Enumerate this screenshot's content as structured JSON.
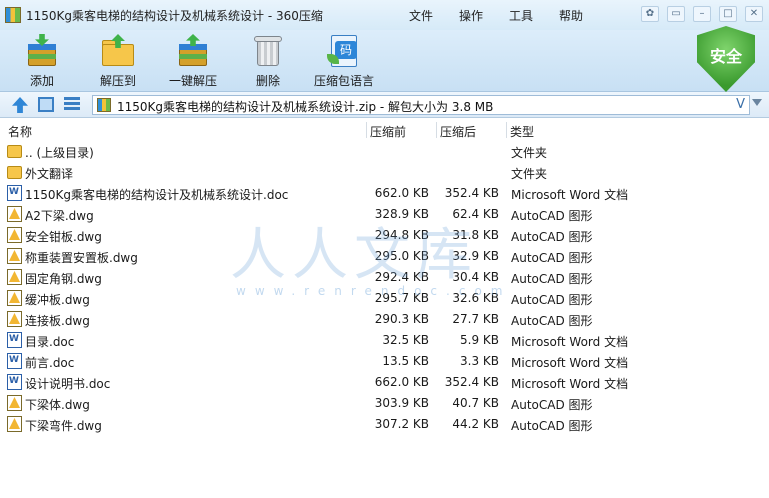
{
  "window": {
    "title": "1150Kg乘客电梯的结构设计及机械系统设计 - 360压缩",
    "menus": [
      "文件",
      "操作",
      "工具",
      "帮助"
    ]
  },
  "toolbar": {
    "add": "添加",
    "extract_to": "解压到",
    "one_click_extract": "一键解压",
    "delete": "删除",
    "archive_language": "压缩包语言",
    "security_badge": "安全"
  },
  "address": {
    "path": "1150Kg乘客电梯的结构设计及机械系统设计.zip - 解包大小为 3.8 MB",
    "dropdown_glyph": "V"
  },
  "columns": {
    "name": "名称",
    "size": "压缩前",
    "packed": "压缩后",
    "type": "类型"
  },
  "files": [
    {
      "name": ".. (上级目录)",
      "size": "",
      "packed": "",
      "type": "文件夹",
      "icon": "folder-icon"
    },
    {
      "name": "外文翻译",
      "size": "",
      "packed": "",
      "type": "文件夹",
      "icon": "folder-icon"
    },
    {
      "name": "1150Kg乘客电梯的结构设计及机械系统设计.doc",
      "size": "662.0 KB",
      "packed": "352.4 KB",
      "type": "Microsoft Word 文档",
      "icon": "word-doc-icon"
    },
    {
      "name": "A2下梁.dwg",
      "size": "328.9 KB",
      "packed": "62.4 KB",
      "type": "AutoCAD 图形",
      "icon": "autocad-dwg-icon"
    },
    {
      "name": "安全钳板.dwg",
      "size": "294.8 KB",
      "packed": "31.8 KB",
      "type": "AutoCAD 图形",
      "icon": "autocad-dwg-icon"
    },
    {
      "name": "称重装置安置板.dwg",
      "size": "295.0 KB",
      "packed": "32.9 KB",
      "type": "AutoCAD 图形",
      "icon": "autocad-dwg-icon"
    },
    {
      "name": "固定角钢.dwg",
      "size": "292.4 KB",
      "packed": "30.4 KB",
      "type": "AutoCAD 图形",
      "icon": "autocad-dwg-icon"
    },
    {
      "name": "缓冲板.dwg",
      "size": "295.7 KB",
      "packed": "32.6 KB",
      "type": "AutoCAD 图形",
      "icon": "autocad-dwg-icon"
    },
    {
      "name": "连接板.dwg",
      "size": "290.3 KB",
      "packed": "27.7 KB",
      "type": "AutoCAD 图形",
      "icon": "autocad-dwg-icon"
    },
    {
      "name": "目录.doc",
      "size": "32.5 KB",
      "packed": "5.9 KB",
      "type": "Microsoft Word 文档",
      "icon": "word-doc-icon"
    },
    {
      "name": "前言.doc",
      "size": "13.5 KB",
      "packed": "3.3 KB",
      "type": "Microsoft Word 文档",
      "icon": "word-doc-icon"
    },
    {
      "name": "设计说明书.doc",
      "size": "662.0 KB",
      "packed": "352.4 KB",
      "type": "Microsoft Word 文档",
      "icon": "word-doc-icon"
    },
    {
      "name": "下梁体.dwg",
      "size": "303.9 KB",
      "packed": "40.7 KB",
      "type": "AutoCAD 图形",
      "icon": "autocad-dwg-icon"
    },
    {
      "name": "下梁弯件.dwg",
      "size": "307.2 KB",
      "packed": "44.2 KB",
      "type": "AutoCAD 图形",
      "icon": "autocad-dwg-icon"
    }
  ],
  "watermark": {
    "text": "人人文库",
    "url": "www.renrendoc.com"
  }
}
